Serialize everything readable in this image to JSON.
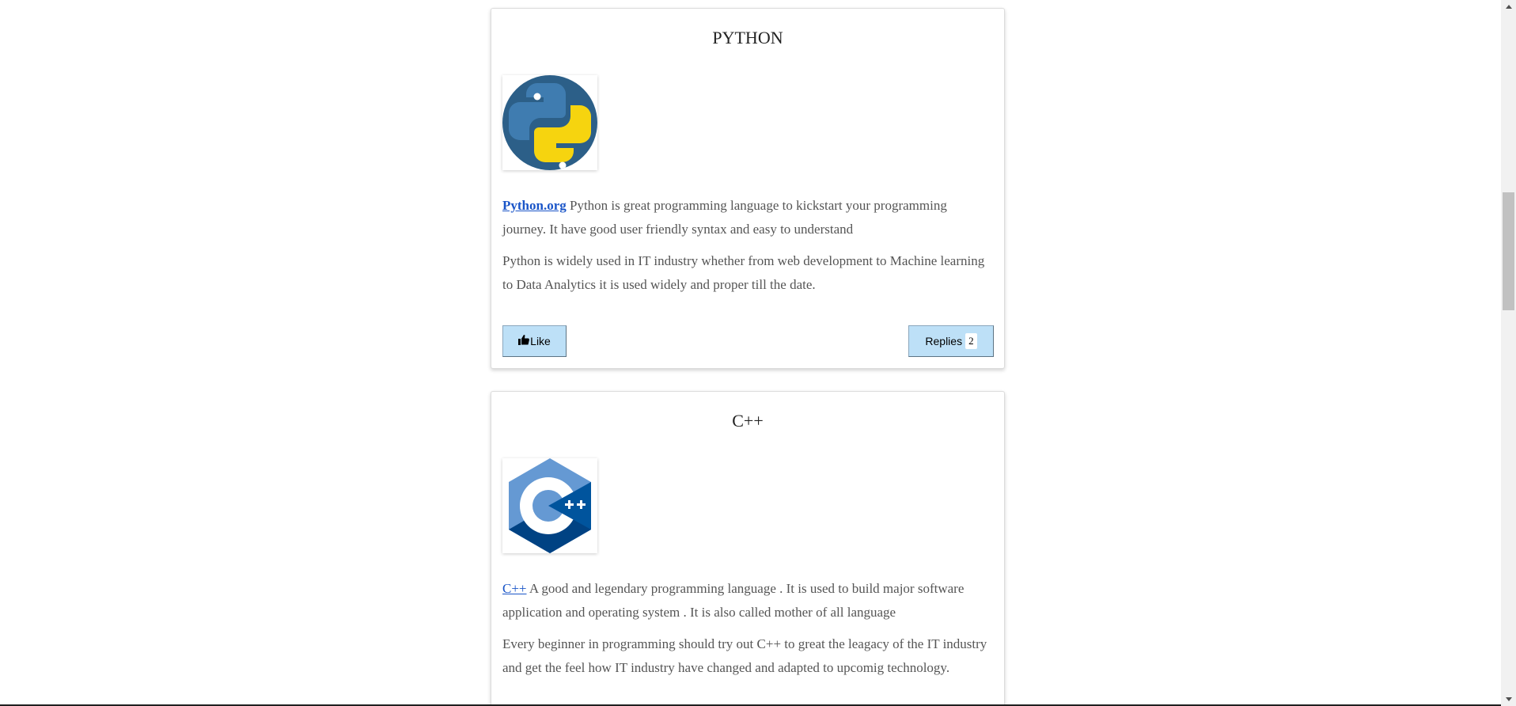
{
  "posts": [
    {
      "title": "PYTHON",
      "logo_icon": "python-logo-icon",
      "link_text": "Python.org",
      "paragraph1": " Python is great programming language to kickstart your programming journey. It have good user friendly syntax and easy to understand",
      "paragraph2": "Python is widely used in IT industry whether from web development to Machine learning to Data Analytics it is used widely and proper till the date.",
      "like_label": "Like",
      "replies_label": "Replies",
      "replies_count": "2"
    },
    {
      "title": "C++",
      "logo_icon": "cpp-logo-icon",
      "link_text": "C++",
      "paragraph1": " A good and legendary programming language . It is used to build major software application and operating system . It is also called mother of all language",
      "paragraph2": "Every beginner in programming should try out C++ to great the leagacy of the IT industry and get the feel how IT industry have changed and adapted to upcomig technology."
    }
  ],
  "colors": {
    "button_bg": "#bde0f7",
    "link": "#1a55c8",
    "text": "#555555",
    "python_blue": "#366c9c",
    "python_yellow": "#f6d40f",
    "cpp_blue": "#5b8fd0",
    "cpp_dark": "#00427e"
  }
}
